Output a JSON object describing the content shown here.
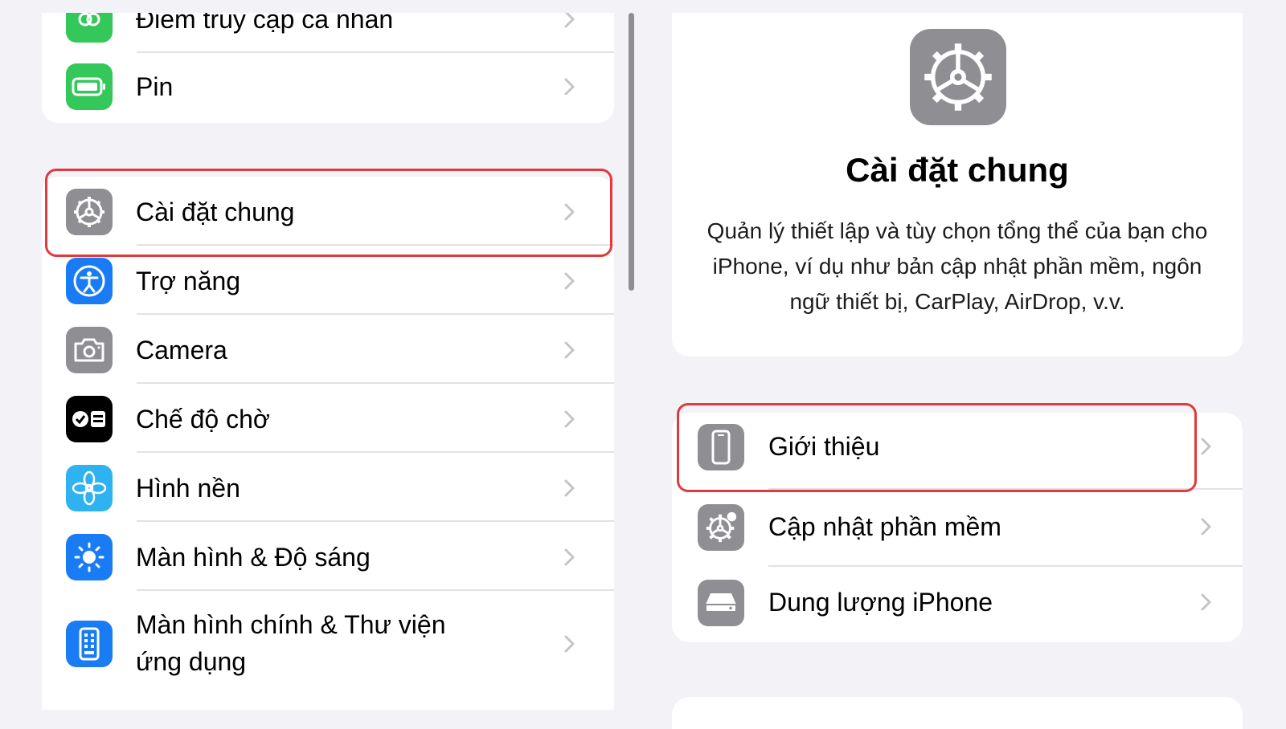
{
  "left": {
    "top_items": [
      {
        "label": "Điểm truy cập cá nhân",
        "icon": "personal-hotspot-icon",
        "color": "#34c759"
      },
      {
        "label": "Pin",
        "icon": "battery-icon",
        "color": "#34c759"
      }
    ],
    "main_items": [
      {
        "label": "Cài đặt chung",
        "icon": "gear-icon",
        "color": "#8e8e93"
      },
      {
        "label": "Trợ năng",
        "icon": "accessibility-icon",
        "color": "#1a7cf5"
      },
      {
        "label": "Camera",
        "icon": "camera-icon",
        "color": "#8e8e93"
      },
      {
        "label": "Chế độ chờ",
        "icon": "standby-icon",
        "color": "#000000"
      },
      {
        "label": "Hình nền",
        "icon": "wallpaper-flower-icon",
        "color": "#2fb3f0"
      },
      {
        "label": "Màn hình & Độ sáng",
        "icon": "brightness-sun-icon",
        "color": "#1a7cf5"
      },
      {
        "label": "Màn hình chính & Thư viện",
        "label_line2": "ứng dụng",
        "icon": "home-screen-icon",
        "color": "#1a7cf5"
      }
    ]
  },
  "right": {
    "header": {
      "title": "Cài đặt chung",
      "description": "Quản lý thiết lập và tùy chọn tổng thể của bạn cho iPhone, ví dụ như bản cập nhật phần mềm, ngôn ngữ thiết bị, CarPlay, AirDrop, v.v.",
      "icon": "gear-icon",
      "icon_color": "#8e8e93"
    },
    "items": [
      {
        "label": "Giới thiệu",
        "icon": "iphone-icon",
        "color": "#8e8e93"
      },
      {
        "label": "Cập nhật phần mềm",
        "icon": "software-update-gear-icon",
        "color": "#8e8e93"
      },
      {
        "label": "Dung lượng iPhone",
        "icon": "storage-drive-icon",
        "color": "#8e8e93"
      }
    ]
  },
  "colors": {
    "highlight": "#e03a3e",
    "background": "#f2f2f7",
    "chevron": "#c4c4c7"
  }
}
